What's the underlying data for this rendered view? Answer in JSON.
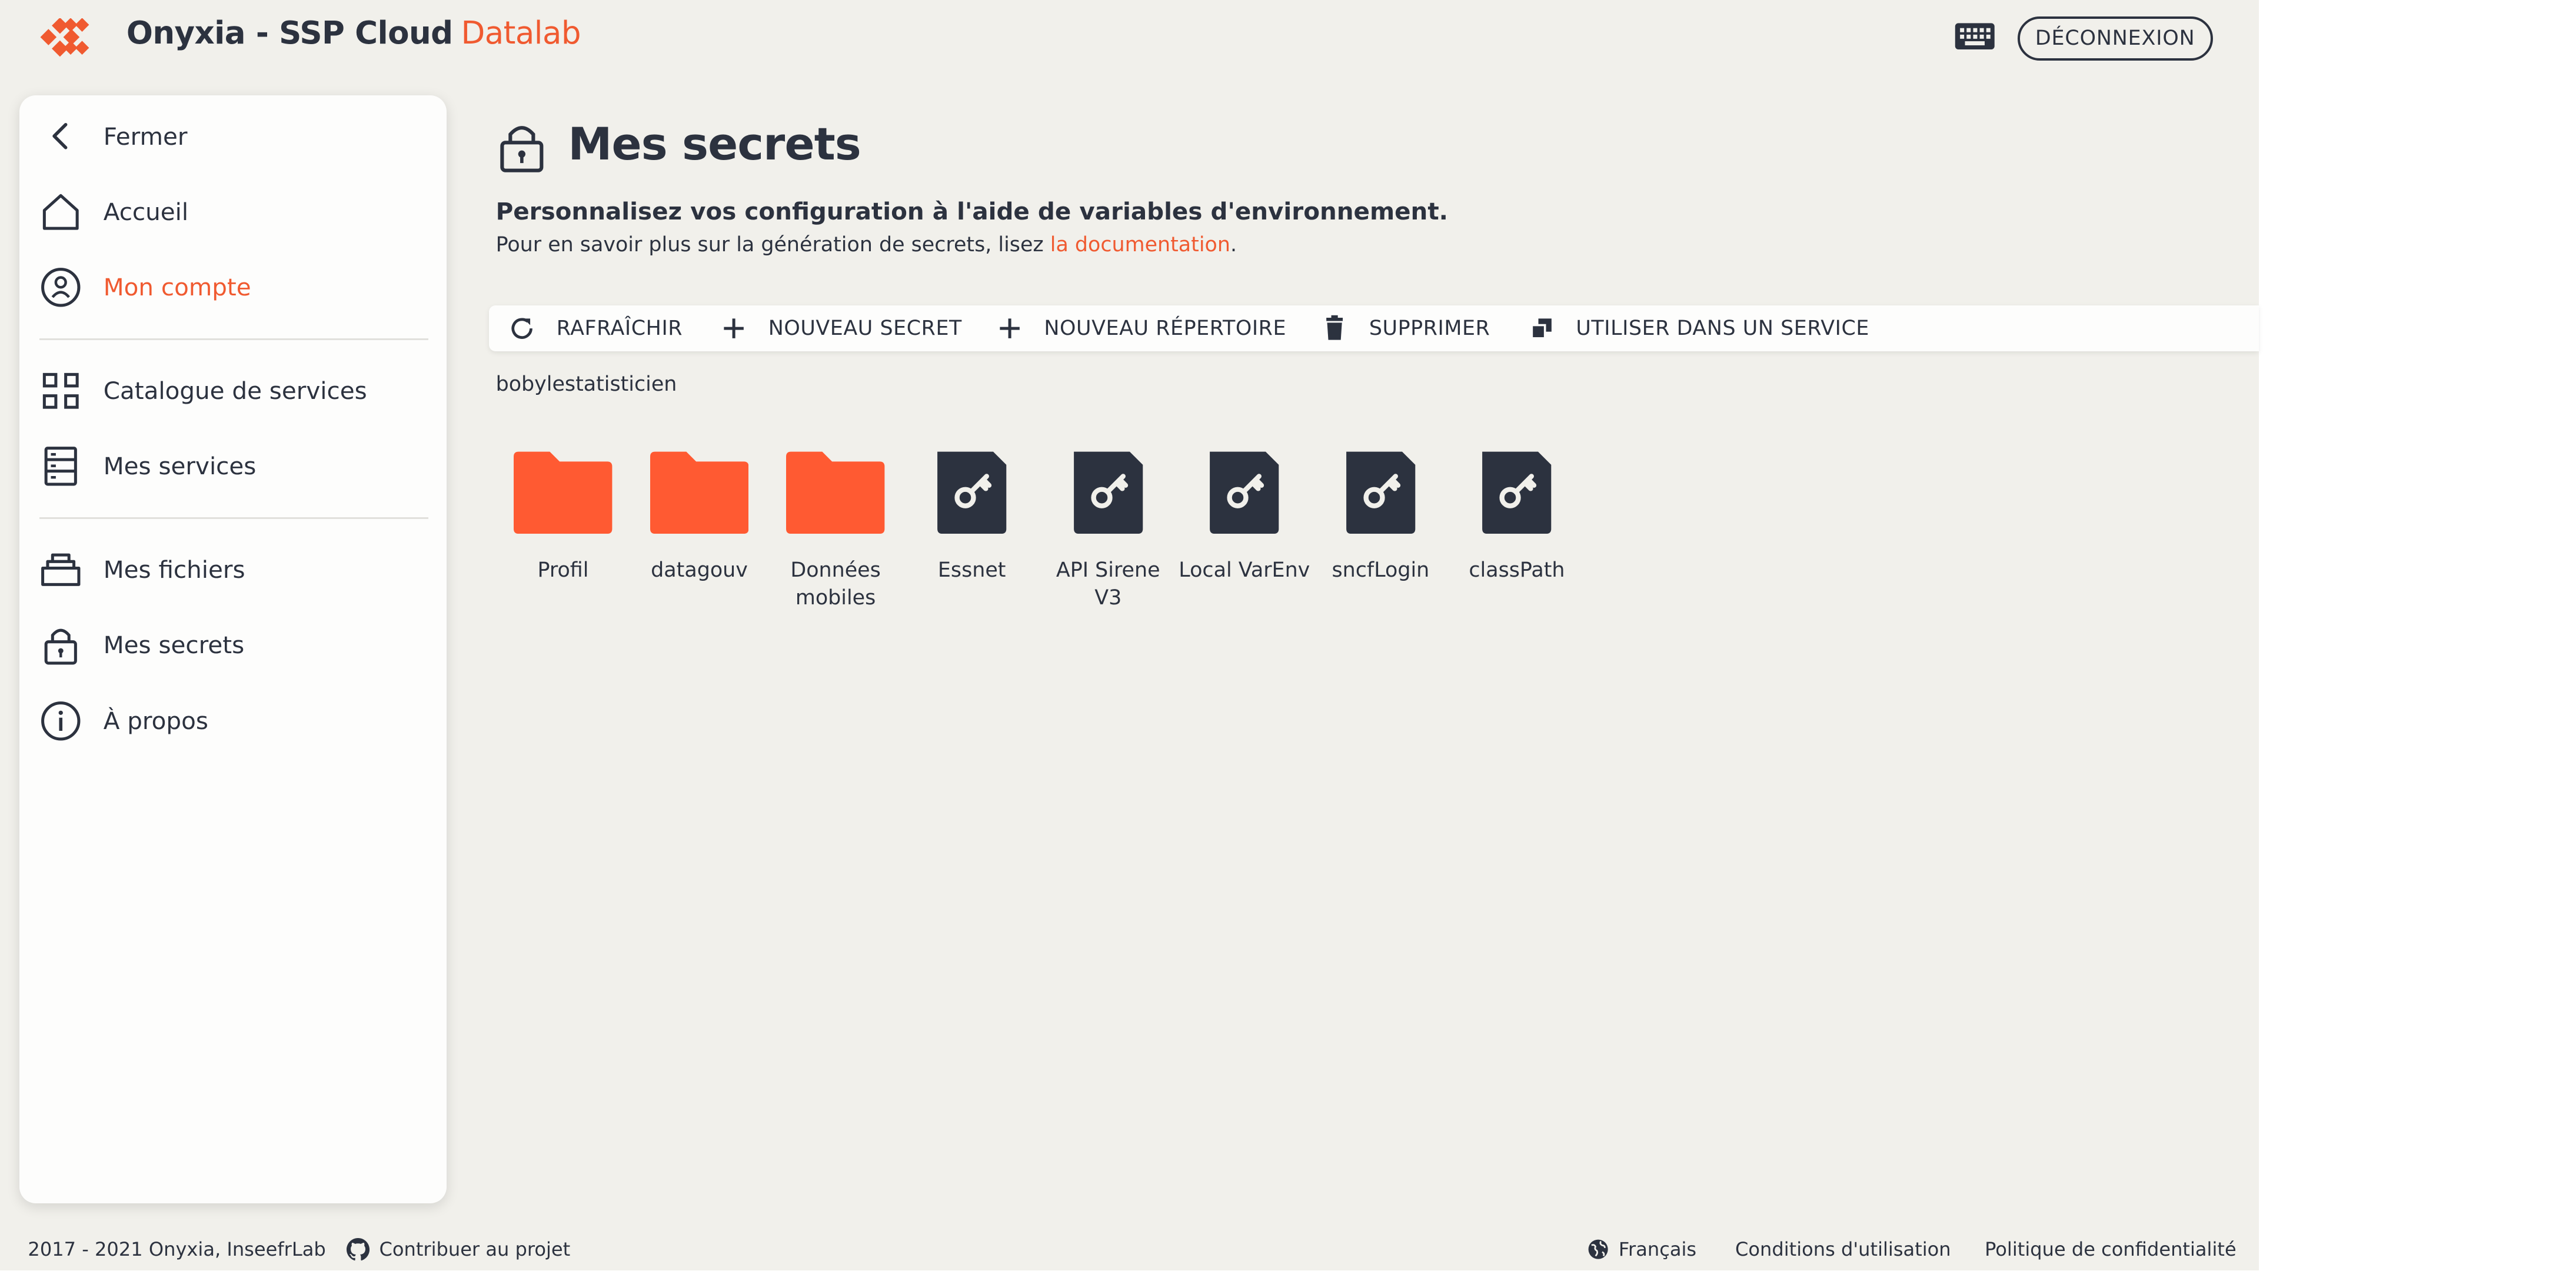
{
  "header": {
    "app_name": "Onyxia - SSP Cloud",
    "app_suffix": "Datalab",
    "logout_label": "DÉCONNEXION"
  },
  "sidebar": {
    "items": [
      {
        "label": "Fermer",
        "icon": "chevron-left-icon"
      },
      {
        "label": "Accueil",
        "icon": "home-icon"
      },
      {
        "label": "Mon compte",
        "icon": "account-icon",
        "active": true
      },
      {
        "label": "Catalogue de services",
        "icon": "grid-icon"
      },
      {
        "label": "Mes services",
        "icon": "server-icon"
      },
      {
        "label": "Mes fichiers",
        "icon": "storage-icon"
      },
      {
        "label": "Mes secrets",
        "icon": "lock-icon"
      },
      {
        "label": "À propos",
        "icon": "info-icon"
      }
    ]
  },
  "main": {
    "title": "Mes secrets",
    "subtitle": "Personnalisez vos configuration à l'aide de variables d'environnement.",
    "desc_prefix": "Pour en savoir plus sur la génération de secrets, lisez ",
    "desc_link": "la documentation",
    "desc_suffix": ".",
    "toolbar": [
      {
        "label": "RAFRAÎCHIR",
        "icon": "refresh-icon"
      },
      {
        "label": "NOUVEAU SECRET",
        "icon": "plus-icon"
      },
      {
        "label": "NOUVEAU RÉPERTOIRE",
        "icon": "plus-icon"
      },
      {
        "label": "SUPPRIMER",
        "icon": "trash-icon"
      },
      {
        "label": "UTILISER DANS UN SERVICE",
        "icon": "copy-icon"
      }
    ],
    "path": "bobylestatisticien",
    "items": [
      {
        "name": "Profil",
        "kind": "folder"
      },
      {
        "name": "datagouv",
        "kind": "folder"
      },
      {
        "name": "Données mobiles",
        "kind": "folder"
      },
      {
        "name": "Essnet",
        "kind": "secret"
      },
      {
        "name": "API Sirene V3",
        "kind": "secret"
      },
      {
        "name": "Local VarEnv",
        "kind": "secret"
      },
      {
        "name": "sncfLogin",
        "kind": "secret"
      },
      {
        "name": "classPath",
        "kind": "secret"
      }
    ]
  },
  "footer": {
    "copyright": "2017 - 2021 Onyxia, InseefrLab",
    "contribute": "Contribuer au projet",
    "language": "Français",
    "terms": "Conditions d'utilisation",
    "privacy": "Politique de confidentialité"
  },
  "colors": {
    "accent": "#f05a30",
    "text": "#2c323f",
    "background": "#f1f0eb",
    "surface": "#fdfdfc",
    "folder": "#ff5a32",
    "secret_file": "#2c323f"
  }
}
